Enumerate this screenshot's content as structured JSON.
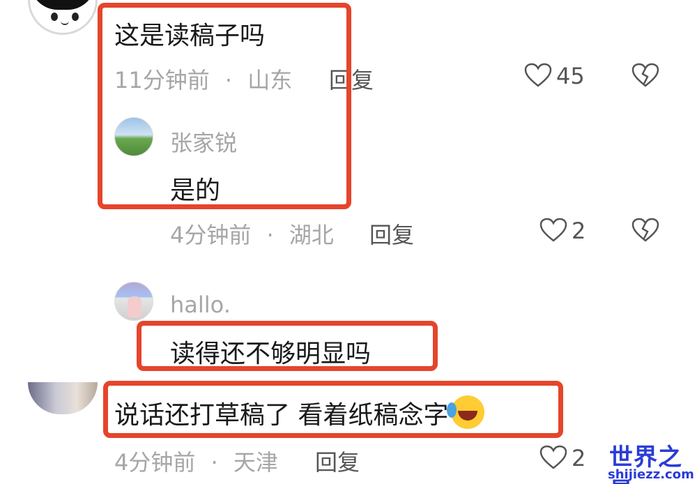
{
  "comments": [
    {
      "text": "这是读稿子吗",
      "time": "11分钟前",
      "sep": "·",
      "location": "山东",
      "reply_label": "回复",
      "likes": "45",
      "replies": [
        {
          "author": "张家锐",
          "text": "是的",
          "time": "4分钟前",
          "sep": "·",
          "location": "湖北",
          "reply_label": "回复",
          "likes": "2"
        },
        {
          "author": "hallo.",
          "text": "读得还不够明显吗"
        }
      ]
    },
    {
      "text": "说话还打草稿了 看着纸稿念字",
      "time": "4分钟前",
      "sep": "·",
      "location": "天津",
      "reply_label": "回复",
      "likes": "2"
    }
  ],
  "icons": {
    "like": "heart-outline-icon",
    "dislike": "broken-heart-icon"
  },
  "watermark": {
    "title": "世界之最",
    "url": "shijiezz.com"
  },
  "colors": {
    "annotation": "#e5452c",
    "muted_text": "#a6a6a6",
    "watermark": "#2a3cd6"
  }
}
